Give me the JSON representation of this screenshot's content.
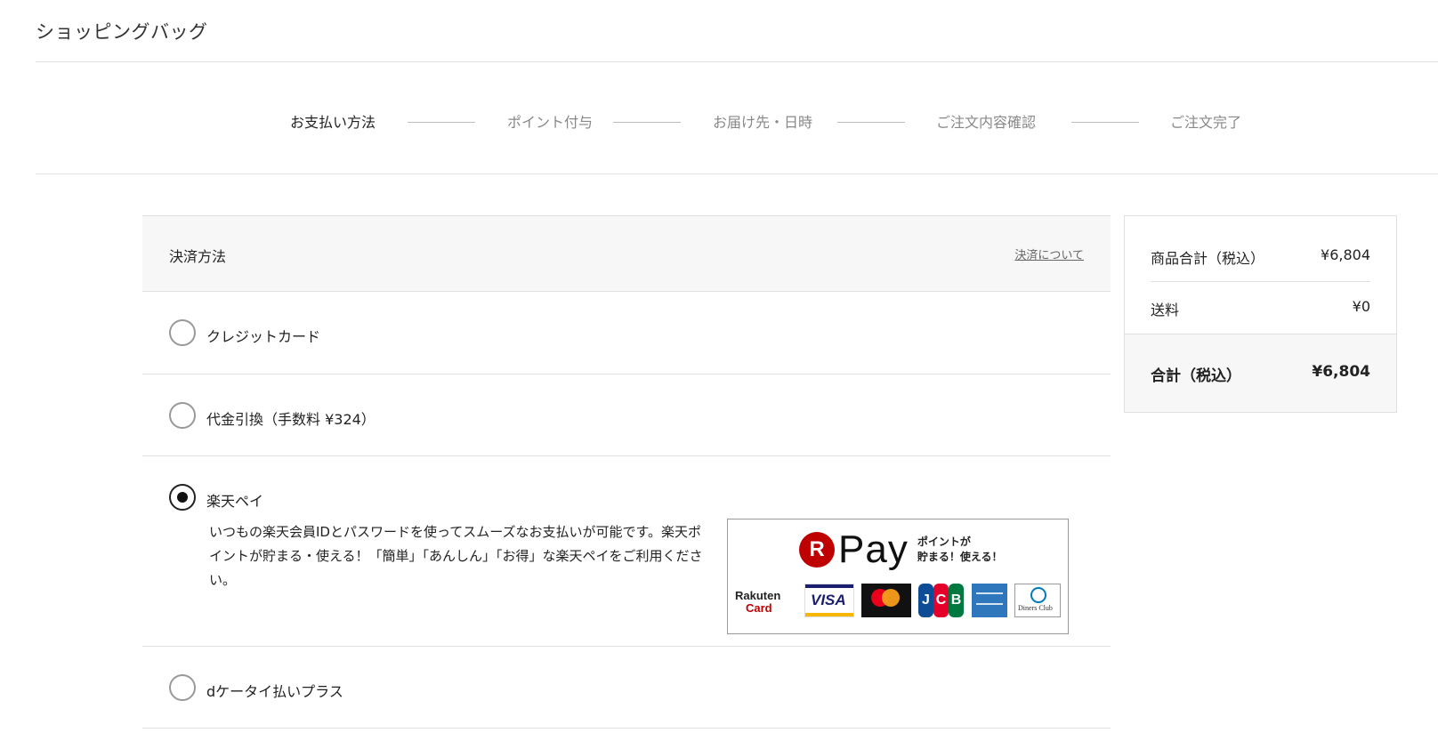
{
  "header": {
    "title": "ショッピングバッグ"
  },
  "steps": [
    {
      "label": "お支払い方法",
      "active": true
    },
    {
      "label": "ポイント付与",
      "active": false
    },
    {
      "label": "お届け先・日時",
      "active": false
    },
    {
      "label": "ご注文内容確認",
      "active": false
    },
    {
      "label": "ご注文完了",
      "active": false
    }
  ],
  "payment": {
    "header_title": "決済方法",
    "about_link": "決済について",
    "options": [
      {
        "label": "クレジットカード",
        "selected": false
      },
      {
        "label": "代金引換（手数料 ¥324）",
        "selected": false
      },
      {
        "label": "楽天ペイ",
        "selected": true,
        "description": "いつもの楽天会員IDとパスワードを使ってスムーズなお支払いが可能です。楽天ポイントが貯まる・使える！「簡単」「あんしん」「お得」な楽天ペイをご利用ください。"
      },
      {
        "label": "dケータイ払いプラス",
        "selected": false
      }
    ],
    "rpay_banner": {
      "r_mark": "R",
      "pay_text": "Pay",
      "tagline_1": "ポイントが",
      "tagline_2": "貯まる！使える！",
      "rakuten_card_1": "Rakuten",
      "rakuten_card_2": "Card",
      "visa_text": "VISA",
      "jcb_letters": [
        "J",
        "C",
        "B"
      ],
      "diners_text": "Diners Club"
    }
  },
  "summary": {
    "subtotal_label": "商品合計（税込）",
    "subtotal_value": "¥6,804",
    "shipping_label": "送料",
    "shipping_value": "¥0",
    "total_label": "合計（税込）",
    "total_value": "¥6,804"
  },
  "colors": {
    "rakuten_red": "#bf0000",
    "visa_blue": "#1a1f71"
  }
}
